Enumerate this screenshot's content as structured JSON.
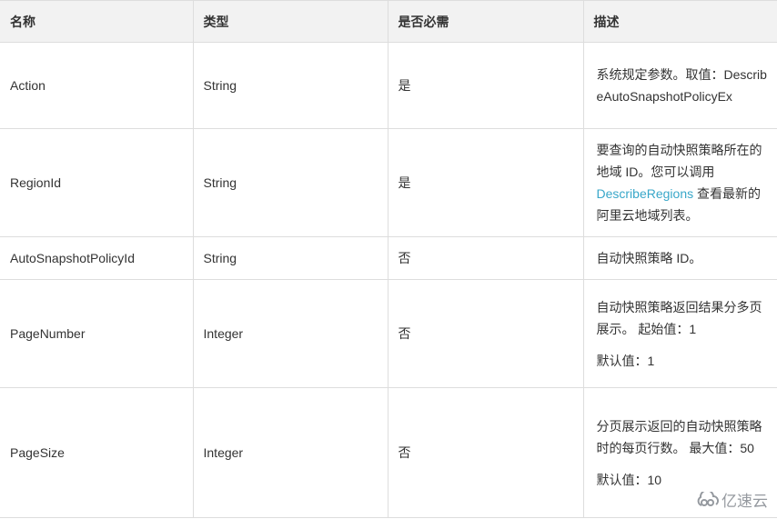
{
  "table": {
    "headers": [
      "名称",
      "类型",
      "是否必需",
      "描述"
    ],
    "rows": [
      {
        "name": "Action",
        "type": "String",
        "required": "是",
        "desc": {
          "text": "系统规定参数。取值：DescribeAutoSnapshotPolicyEx"
        }
      },
      {
        "name": "RegionId",
        "type": "String",
        "required": "是",
        "desc": {
          "before": "要查询的自动快照策略所在的地域 ID。您可以调用 ",
          "link": "DescribeRegions",
          "after": " 查看最新的阿里云地域列表。"
        }
      },
      {
        "name": "AutoSnapshotPolicyId",
        "type": "String",
        "required": "否",
        "desc": {
          "text": "自动快照策略 ID。"
        }
      },
      {
        "name": "PageNumber",
        "type": "Integer",
        "required": "否",
        "desc": {
          "text": "自动快照策略返回结果分多页展示。 起始值：1",
          "default": "默认值：1"
        }
      },
      {
        "name": "PageSize",
        "type": "Integer",
        "required": "否",
        "desc": {
          "text": "分页展示返回的自动快照策略时的每页行数。 最大值：50",
          "default": "默认值：10"
        }
      }
    ]
  },
  "watermark": {
    "icon": "cloud-logo-icon",
    "text": "亿速云"
  },
  "colors": {
    "link": "#39a7c9",
    "header_bg": "#f2f2f2",
    "border": "#dddddd"
  }
}
